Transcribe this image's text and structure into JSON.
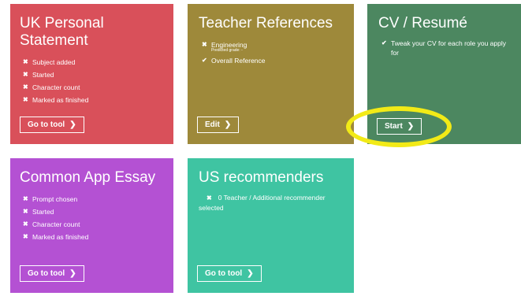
{
  "cards": {
    "uk": {
      "title": "UK Personal Statement",
      "items": [
        {
          "icon": "cross",
          "text": "Subject added"
        },
        {
          "icon": "cross",
          "text": "Started"
        },
        {
          "icon": "cross",
          "text": "Character count"
        },
        {
          "icon": "cross",
          "text": "Marked as finished"
        }
      ],
      "button": "Go to tool",
      "color": "#d9505a"
    },
    "teacher": {
      "title": "Teacher References",
      "items": [
        {
          "icon": "cross",
          "text": "Engineering",
          "sub": "Predicted grade: -"
        },
        {
          "icon": "check",
          "text": "Overall Reference"
        }
      ],
      "button": "Edit",
      "color": "#9e893a"
    },
    "cv": {
      "title": "CV / Resumé",
      "items": [
        {
          "icon": "check",
          "text": "Tweak your CV for each role you apply for"
        }
      ],
      "button": "Start",
      "color": "#4c8760"
    },
    "common": {
      "title": "Common App Essay",
      "items": [
        {
          "icon": "cross",
          "text": "Prompt chosen"
        },
        {
          "icon": "cross",
          "text": "Started"
        },
        {
          "icon": "cross",
          "text": "Character count"
        },
        {
          "icon": "cross",
          "text": "Marked as finished"
        }
      ],
      "button": "Go to tool",
      "color": "#b451d3"
    },
    "us": {
      "title": "US recommenders",
      "status_icon": "cross",
      "status": "0 Teacher / Additional recommender selected",
      "button": "Go to tool",
      "color": "#3fc4a2"
    }
  },
  "icons": {
    "cross": "✖",
    "check": "✔",
    "chevron": "❯"
  },
  "highlight_color": "#f2ea17"
}
